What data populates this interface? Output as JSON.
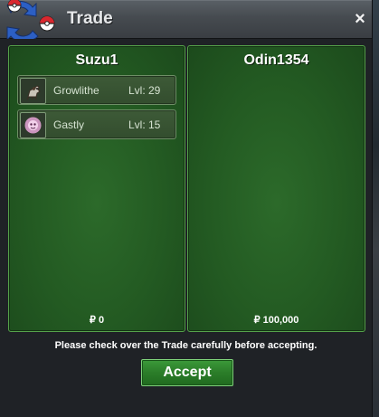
{
  "window": {
    "title": "Trade",
    "close_label": "×"
  },
  "left_panel": {
    "player_name": "Suzu1",
    "pokemon": [
      {
        "name": "Growlithe",
        "level": "Lvl: 29",
        "icon": "growlithe-icon"
      },
      {
        "name": "Gastly",
        "level": "Lvl: 15",
        "icon": "gastly-icon"
      }
    ],
    "money": "₽ 0"
  },
  "right_panel": {
    "player_name": "Odin1354",
    "pokemon": [],
    "money": "₽ 100,000"
  },
  "notice": "Please check over the Trade carefully before accepting.",
  "accept_label": "Accept",
  "colors": {
    "panel_green": "#235a22",
    "panel_border": "#55a24a",
    "accept_green": "#2b7d29",
    "titlebar": "#464b50",
    "window_bg": "#222428"
  }
}
